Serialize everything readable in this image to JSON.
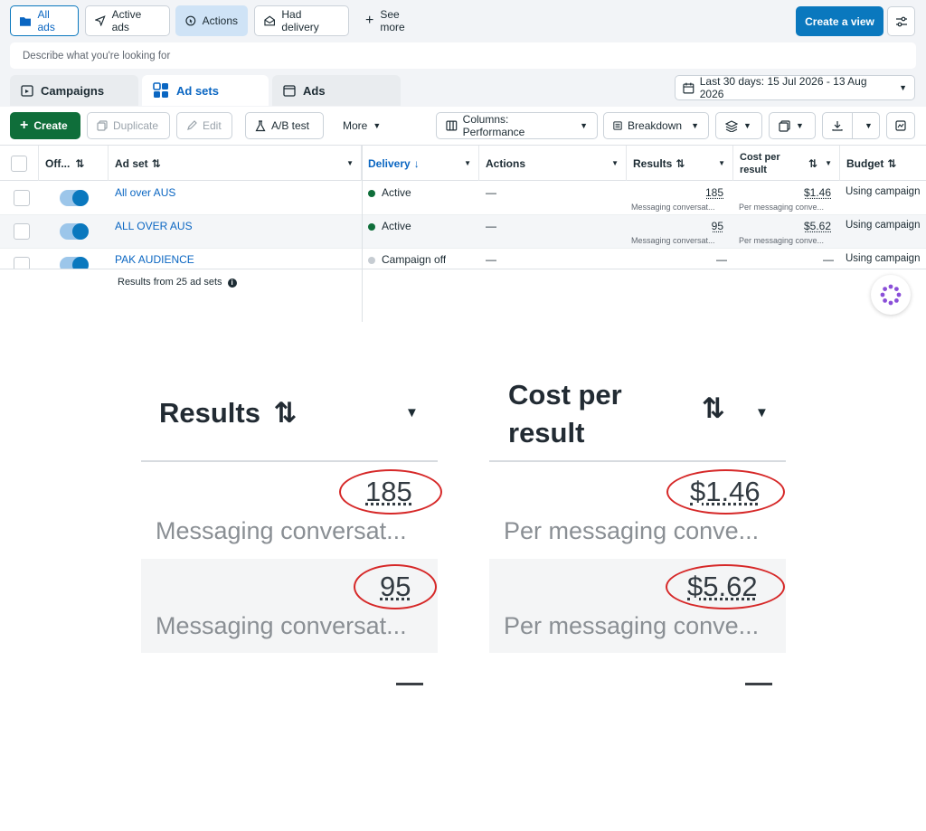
{
  "view_tabs": {
    "all_ads": "All ads",
    "active_ads": "Active ads",
    "actions": "Actions",
    "had_delivery": "Had delivery",
    "see_more": "See more",
    "create_view": "Create a view"
  },
  "search": {
    "placeholder": "Describe what you're looking for"
  },
  "level_tabs": {
    "campaigns": "Campaigns",
    "ad_sets": "Ad sets",
    "ads": "Ads"
  },
  "date_range": "Last 30 days: 15 Jul 2026 - 13 Aug 2026",
  "toolbar": {
    "create": "Create",
    "duplicate": "Duplicate",
    "edit": "Edit",
    "ab_test": "A/B test",
    "more": "More",
    "columns": "Columns: Performance",
    "breakdown": "Breakdown"
  },
  "table": {
    "headers": {
      "off_on": "Off...",
      "ad_set": "Ad set",
      "delivery": "Delivery",
      "actions": "Actions",
      "results": "Results",
      "cost_per_result": "Cost per result",
      "budget": "Budget"
    },
    "rows": [
      {
        "name": "All over AUS",
        "delivery": "Active",
        "actions": "—",
        "results": "185",
        "results_sub": "Messaging conversat...",
        "cost": "$1.46",
        "cost_sub": "Per messaging conve...",
        "budget": "Using campaign"
      },
      {
        "name": "ALL OVER AUS",
        "delivery": "Active",
        "actions": "—",
        "results": "95",
        "results_sub": "Messaging conversat...",
        "cost": "$5.62",
        "cost_sub": "Per messaging conve...",
        "budget": "Using campaign"
      },
      {
        "name": "PAK AUDIENCE",
        "delivery": "Campaign off",
        "actions": "—",
        "results": "—",
        "results_sub": "",
        "cost": "—",
        "cost_sub": "",
        "budget": "Using campaign"
      }
    ],
    "footer": "Results from 25 ad sets"
  },
  "zoom": {
    "results_header": "Results",
    "cost_header_line1": "Cost per",
    "cost_header_line2": "result",
    "results_values": [
      "185",
      "95"
    ],
    "results_sub": "Messaging conversat...",
    "cost_values": [
      "$1.46",
      "$5.62"
    ],
    "cost_sub": "Per messaging conve...",
    "empty_dash": "—"
  },
  "colors": {
    "primary": "#0a78be",
    "create_green": "#0f6e3a",
    "active_dot": "#0f6e3a",
    "off_dot": "#c6ccd2",
    "highlight_circle": "#d62828"
  }
}
